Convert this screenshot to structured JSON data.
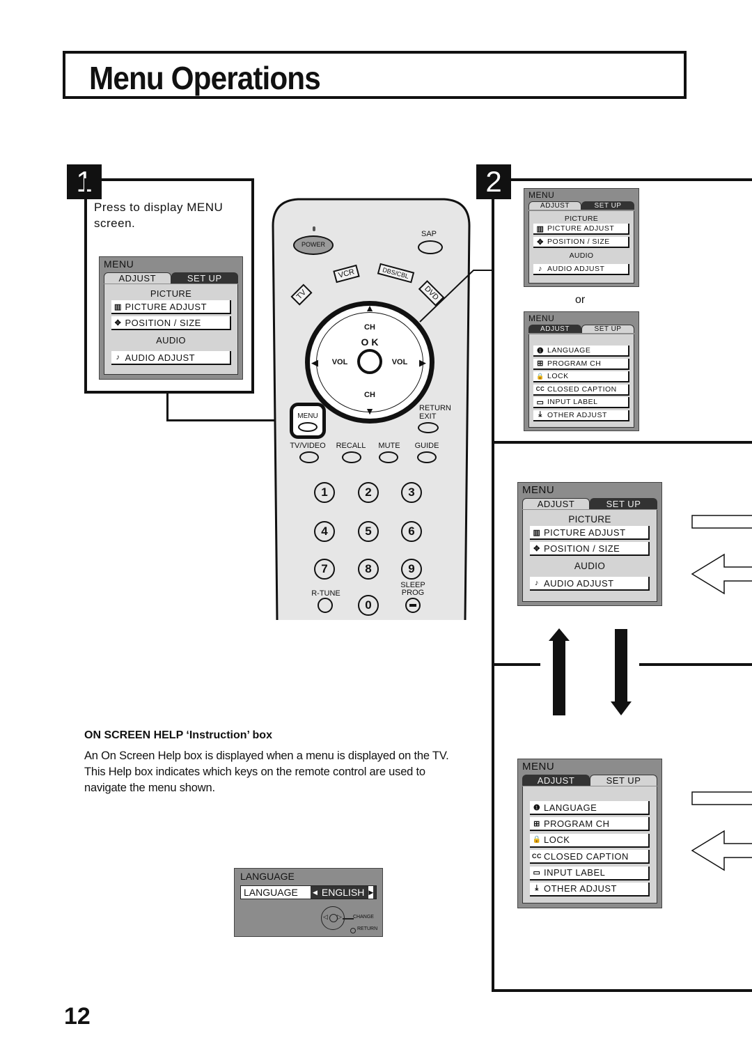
{
  "page": {
    "title": "Menu Operations",
    "page_number": "12"
  },
  "steps": {
    "step1": {
      "number": "1",
      "instruction": "Press to display MENU screen."
    },
    "step2": {
      "number": "2",
      "or_label": "or"
    }
  },
  "menu_adjust": {
    "title": "MENU",
    "tab_adjust": "ADJUST",
    "tab_setup": "SET UP",
    "section_picture": "PICTURE",
    "section_audio": "AUDIO",
    "items": [
      {
        "icon": "picture-adjust-icon",
        "glyph": "▥",
        "label": "PICTURE  ADJUST"
      },
      {
        "icon": "position-size-icon",
        "glyph": "✥",
        "label": "POSITION / SIZE"
      },
      {
        "icon": "music-note-icon",
        "glyph": "♪",
        "label": "AUDIO  ADJUST"
      }
    ]
  },
  "menu_setup": {
    "title": "MENU",
    "tab_adjust": "ADJUST",
    "tab_setup": "SET UP",
    "items": [
      {
        "icon": "language-icon",
        "glyph": "❶",
        "label": "LANGUAGE"
      },
      {
        "icon": "program-ch-icon",
        "glyph": "⊞",
        "label": "PROGRAM  CH"
      },
      {
        "icon": "lock-icon",
        "glyph": "🔒",
        "label": "LOCK"
      },
      {
        "icon": "closed-caption-icon",
        "glyph": "CC",
        "label": "CLOSED  CAPTION"
      },
      {
        "icon": "input-label-icon",
        "glyph": "▭",
        "label": "INPUT  LABEL"
      },
      {
        "icon": "other-adjust-icon",
        "glyph": "⤓",
        "label": "OTHER  ADJUST"
      }
    ]
  },
  "remote": {
    "power": "POWER",
    "sap": "SAP",
    "tv": "TV",
    "vcr": "VCR",
    "dbs_cbl": "DBS/CBL",
    "dvd": "DVD",
    "ch_up": "CH",
    "ok": "O K",
    "vol_left": "VOL",
    "vol_right": "VOL",
    "ch_down": "CH",
    "menu": "MENU",
    "return_exit_1": "RETURN",
    "return_exit_2": "EXIT",
    "tv_video": "TV/VIDEO",
    "recall": "RECALL",
    "mute": "MUTE",
    "guide": "GUIDE",
    "numbers": [
      "1",
      "2",
      "3",
      "4",
      "5",
      "6",
      "7",
      "8",
      "9",
      "0"
    ],
    "r_tune": "R-TUNE",
    "sleep": "SLEEP",
    "prog": "PROG"
  },
  "help": {
    "title": "ON SCREEN HELP ‘Instruction’ box",
    "body": "An On Screen Help box is displayed when a menu is displayed on the TV. This Help box indicates which keys on the remote control are used to navigate the menu shown."
  },
  "help_box": {
    "title": "LANGUAGE",
    "row_label": "LANGUAGE",
    "row_value": "ENGLISH",
    "change_label": "CHANGE",
    "return_label": "RETURN"
  }
}
